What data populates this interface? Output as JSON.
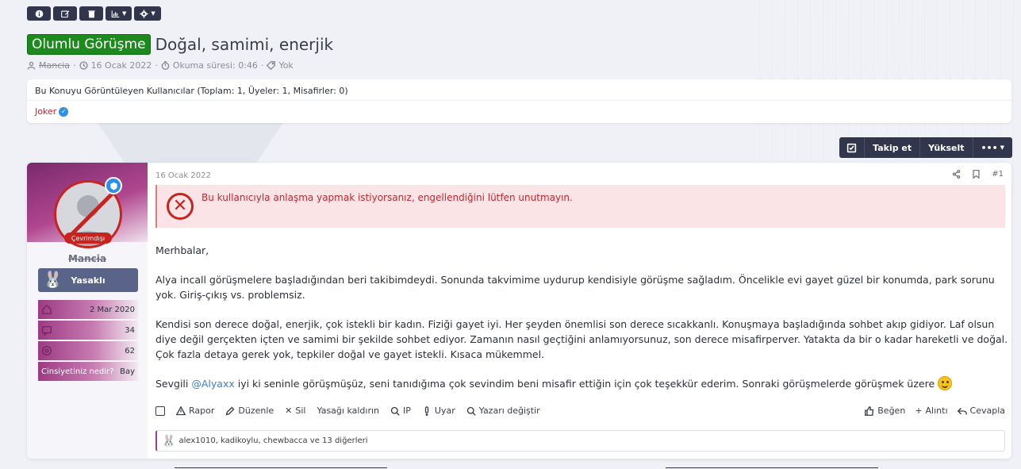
{
  "toolbar": {
    "buttons": [
      {
        "icon": "info-icon"
      },
      {
        "icon": "edit-icon"
      },
      {
        "icon": "trash-icon"
      },
      {
        "icon": "chart-icon"
      },
      {
        "icon": "gear-icon"
      }
    ]
  },
  "thread": {
    "prefix": "Olumlu Görüşme",
    "title": "Doğal, samimi, enerjik",
    "author": "Mancia",
    "date": "16 Ocak 2022",
    "reading_time": "Okuma süresi: 0:46",
    "tags": "Yok",
    "sep": "·"
  },
  "viewers": {
    "title": "Bu Konuyu Görüntüleyen Kullanıcılar (Toplam: 1, Üyeler: 1, Misafirler: 0)",
    "users": [
      "Joker"
    ]
  },
  "follow_bar": {
    "follow_label": "Takip et",
    "bump_label": "Yükselt",
    "more_label": "•••"
  },
  "post": {
    "user": {
      "name": "Mancia",
      "status": "Çevrimdışı",
      "banner": "Yasaklı",
      "stats": [
        {
          "icon": "home-icon",
          "value": "2 Mar 2020"
        },
        {
          "icon": "message-icon",
          "value": "34"
        },
        {
          "icon": "reaction-icon",
          "value": "62"
        },
        {
          "label": "Cinsiyetiniz nedir?",
          "value": "Bay"
        }
      ]
    },
    "date": "16 Ocak 2022",
    "number": "#1",
    "warning": "Bu kullanıcıyla anlaşma yapmak istiyorsanız, engellendiğini lütfen unutmayın.",
    "paragraphs": [
      "Merhbalar,",
      "Alya incall görüşmelere başladığından beri takibimdeydi. Sonunda takvimime uydurup kendisiyle görüşme sağladım. Öncelikle evi gayet güzel bir konumda, park sorunu yok. Giriş-çıkış vs. problemsiz.",
      "Kendisi son derece doğal, enerjik, çok istekli bir kadın. Fiziği gayet iyi. Her şeyden önemlisi son derece sıcakkanlı. Konuşmaya başladığında sohbet akıp gidiyor. Laf olsun diye değil gerçekten içten ve samimi bir şekilde sohbet ediyor. Zamanın nasıl geçtiğini anlamıyorsunuz, son derece misafirperver. Yatakta da bir o kadar hareketli ve doğal. Çok fazla detaya gerek yok, tepkiler doğal ve gayet istekli. Kısaca mükemmel."
    ],
    "last_paragraph": {
      "before": "Sevgili ",
      "mention": "@Alyaxx",
      "after": " iyi ki seninle görüşmüşüz, seni tanıdığıma çok sevindim beni misafir ettiğin için çok teşekkür ederim. Sonraki görüşmelerde görüşmek üzere "
    },
    "actions": {
      "report": "Rapor",
      "edit": "Düzenle",
      "delete": "Sil",
      "unban": "Yasağı kaldırın",
      "ip": "IP",
      "warn": "Uyar",
      "change_author": "Yazarı değiştir",
      "like": "Beğen",
      "quote": "Alıntı",
      "reply": "Cevapla"
    },
    "reactions": "alex1010, kadikoylu, chewbacca ve 13 diğerleri"
  },
  "colors": {
    "prefix_green": "#1c8a1c",
    "dark_button": "#32364d",
    "danger": "#c9231f",
    "link": "#3b7ed6",
    "banner_purple": "#9d3a83"
  }
}
